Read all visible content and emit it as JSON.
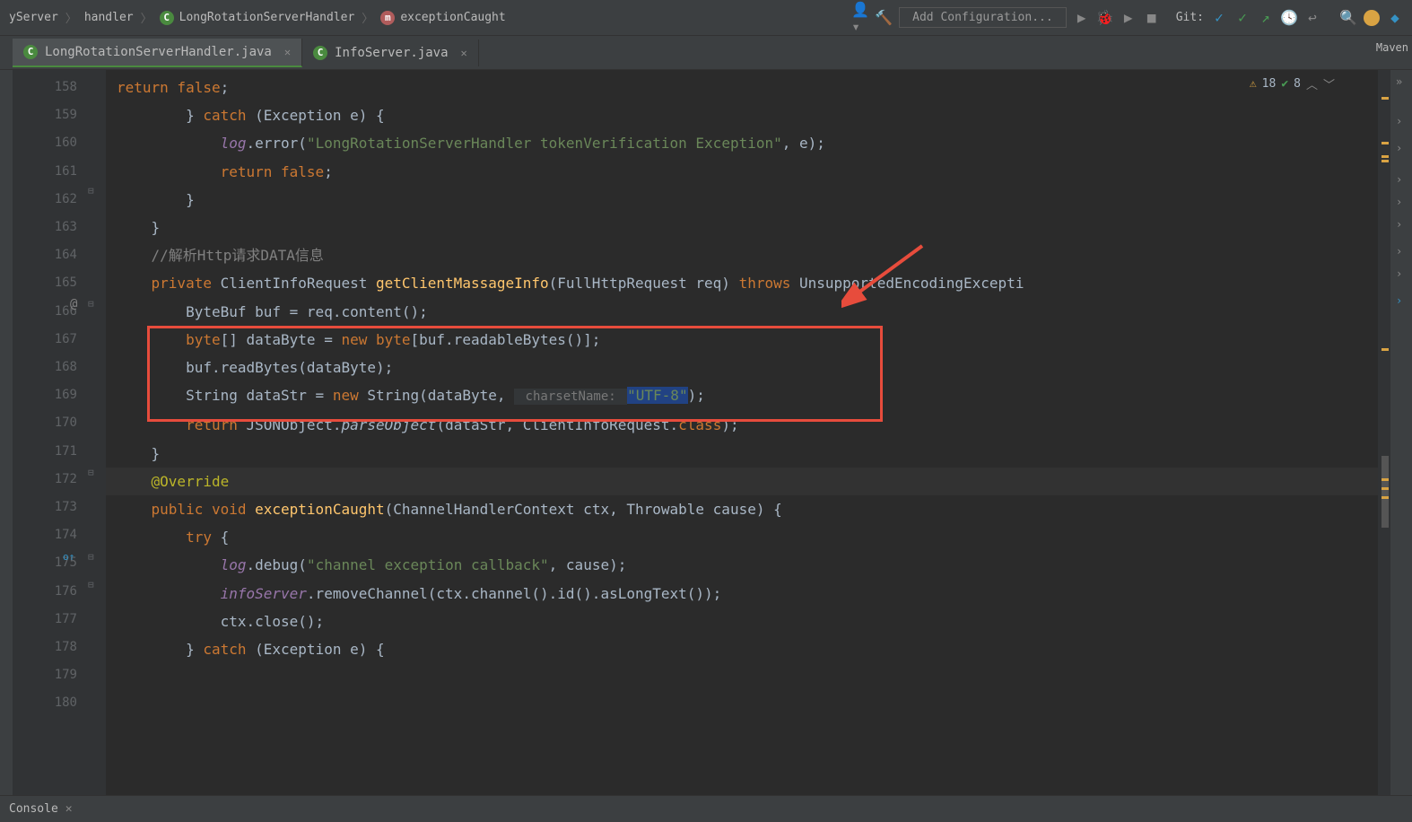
{
  "navbar": {
    "breadcrumbs": [
      "yServer",
      "handler",
      "LongRotationServerHandler",
      "exceptionCaught"
    ],
    "add_config": "Add Configuration...",
    "git_label": "Git:"
  },
  "tabs": {
    "active": "LongRotationServerHandler.java",
    "other": "InfoServer.java",
    "maven": "Maven"
  },
  "inspection": {
    "warnings": "18",
    "checks": "8"
  },
  "gutter": {
    "start": 158,
    "end": 180
  },
  "code": {
    "l158": "            return false;",
    "l159": "        } catch (Exception e) {",
    "l160_a": "            ",
    "l160_b": "log",
    "l160_c": ".error(",
    "l160_d": "\"LongRotationServerHandler tokenVerification Exception\"",
    "l160_e": ", e);",
    "l161": "            return false;",
    "l162": "        }",
    "l163": "    }",
    "l164": "",
    "l165": "    //解析Http请求DATA信息",
    "l166_a": "    private ",
    "l166_b": "ClientInfoRequest ",
    "l166_c": "getClientMassageInfo",
    "l166_d": "(FullHttpRequest req) ",
    "l166_e": "throws ",
    "l166_f": "UnsupportedEncodingExcepti",
    "l167": "        ByteBuf buf = req.content();",
    "l168_a": "        byte",
    "l168_b": "[] dataByte = ",
    "l168_c": "new byte",
    "l168_d": "[buf.readableBytes()];",
    "l169": "        buf.readBytes(dataByte);",
    "l170_a": "        String dataStr = ",
    "l170_b": "new ",
    "l170_c": "String(dataByte, ",
    "l170_hint": " charsetName: ",
    "l170_d": "\"UTF-8\"",
    "l170_e": ");",
    "l171_a": "        return ",
    "l171_b": "JSONObject.",
    "l171_c": "parseObject",
    "l171_d": "(dataStr, ClientInfoRequest.",
    "l171_e": "class",
    "l171_f": ");",
    "l172": "    }",
    "l173": "",
    "l174": "    @Override",
    "l175_a": "    public void ",
    "l175_b": "exceptionCaught",
    "l175_c": "(ChannelHandlerContext ctx, Throwable cause) {",
    "l176": "        try {",
    "l177_a": "            ",
    "l177_b": "log",
    "l177_c": ".debug(",
    "l177_d": "\"channel exception callback\"",
    "l177_e": ", cause);",
    "l178": "            infoServer.removeChannel(ctx.channel().id().asLongText());",
    "l179": "            ctx.close();",
    "l180": "        } catch (Exception e) {"
  },
  "bottom": {
    "console": "Console"
  }
}
